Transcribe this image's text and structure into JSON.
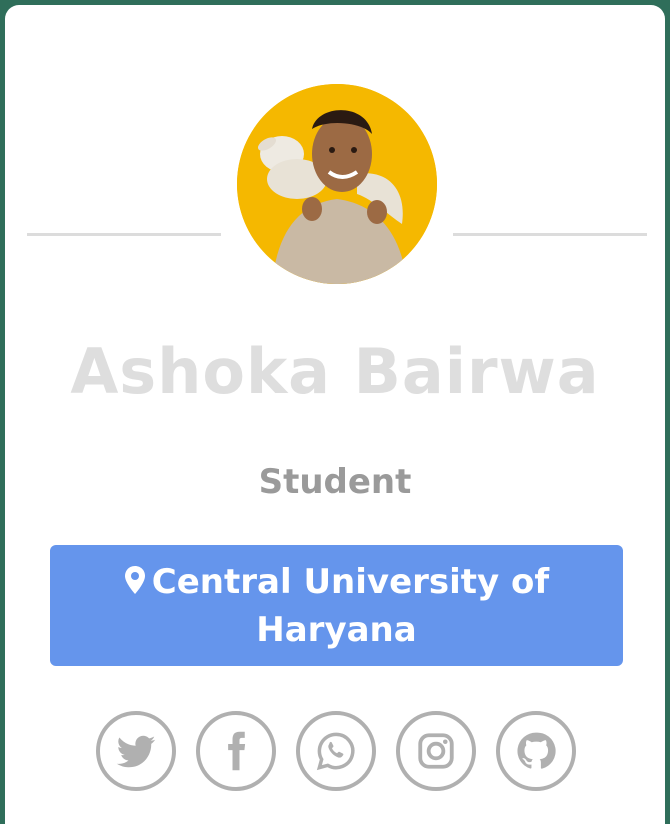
{
  "profile": {
    "name": "Ashoka Bairwa",
    "role": "Student",
    "location": "Central University of Haryana"
  },
  "icons": {
    "location": "map-pin-icon",
    "socials": [
      "twitter-icon",
      "facebook-icon",
      "whatsapp-icon",
      "instagram-icon",
      "github-icon"
    ]
  },
  "colors": {
    "avatar_bg": "#f5b800",
    "location_bg": "#6595ec",
    "icon_gray": "#b0b0b0",
    "name_color": "#dedede",
    "role_color": "#9a9a9a"
  }
}
